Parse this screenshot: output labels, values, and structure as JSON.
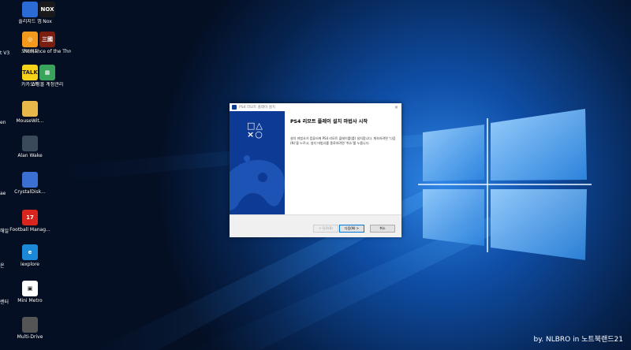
{
  "desktop": {
    "icons": [
      {
        "label": "플리지드 앱",
        "glyph": "",
        "color": "#2b6bd6"
      },
      {
        "label": "Nox",
        "glyph": "NOX",
        "color": "#1a1a1a"
      },
      {
        "label": "오버워치",
        "glyph": "◎",
        "color": "#f39a1d"
      },
      {
        "label": "Romance of the Three K...",
        "glyph": "三國",
        "color": "#7b1e12"
      },
      {
        "label": "카카오톡",
        "glyph": "TALK",
        "color": "#f6d21a"
      },
      {
        "label": "쇼핑몰 계정관리",
        "glyph": "▦",
        "color": "#3aa35b"
      },
      {
        "label": "MouseWit...",
        "glyph": "",
        "color": "#e8b84a"
      },
      {
        "label": "Alan Wake",
        "glyph": "",
        "color": "#3a4a5a"
      },
      {
        "label": "CrystalDisk...",
        "glyph": "",
        "color": "#3b6fd1"
      },
      {
        "label": "Football Manag...",
        "glyph": "17",
        "color": "#d8261f"
      },
      {
        "label": "iexplore",
        "glyph": "e",
        "color": "#1c88d8"
      },
      {
        "label": "Mini Metro",
        "glyph": "▣",
        "color": "#ffffff"
      },
      {
        "label": "Multi-Drive",
        "glyph": "",
        "color": "#555555"
      }
    ],
    "cut_labels": [
      "",
      "t V3",
      "",
      "en",
      "",
      "ae",
      "해일",
      "온",
      "렌터",
      "",
      ""
    ]
  },
  "installer": {
    "title": "PS4 리모트 플레이 설치",
    "close": "×",
    "logo_top": "□△",
    "logo_bottom": "×○",
    "heading": "PS4 리모트 플레이 설치 마법사 시작",
    "body": "설치 마법사가 컴퓨터에 PS4 리모트 플레이를(를) 설치합니다. 계속하려면 '다음(N)'을 누르고, 설치 마법사를 종료하려면 '취소'를 누릅니다.",
    "buttons": {
      "back": "< 뒤로(B)",
      "next": "다음(N) >",
      "cancel": "취소"
    }
  },
  "watermark": "by. NLBRO in 노트북랜드21",
  "colors": {
    "banner": "#0d3a94",
    "wallpaper": "#06162e",
    "accent": "#0078d7"
  }
}
